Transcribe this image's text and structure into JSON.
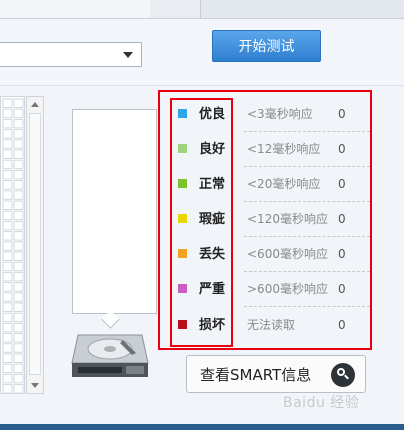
{
  "toolbar": {
    "start_button": "开始测试",
    "dropdown_value": ""
  },
  "legend": {
    "items": [
      {
        "label": "优良",
        "desc": "<3毫秒响应",
        "count": "0",
        "color": "#2fa6e6"
      },
      {
        "label": "良好",
        "desc": "<12毫秒响应",
        "count": "0",
        "color": "#9fd37d"
      },
      {
        "label": "正常",
        "desc": "<20毫秒响应",
        "count": "0",
        "color": "#7cc22a"
      },
      {
        "label": "瑕疵",
        "desc": "<120毫秒响应",
        "count": "0",
        "color": "#e8d800"
      },
      {
        "label": "丢失",
        "desc": "<600毫秒响应",
        "count": "0",
        "color": "#f2a21e"
      },
      {
        "label": "严重",
        "desc": ">600毫秒响应",
        "count": "0",
        "color": "#cc5bc2"
      },
      {
        "label": "损坏",
        "desc": "无法读取",
        "count": "0",
        "color": "#b80f18"
      }
    ],
    "highlight_color": "#e60012"
  },
  "smart_button": {
    "label": "查看SMART信息",
    "icon": "search-icon"
  },
  "watermark": "Baidu 经验"
}
